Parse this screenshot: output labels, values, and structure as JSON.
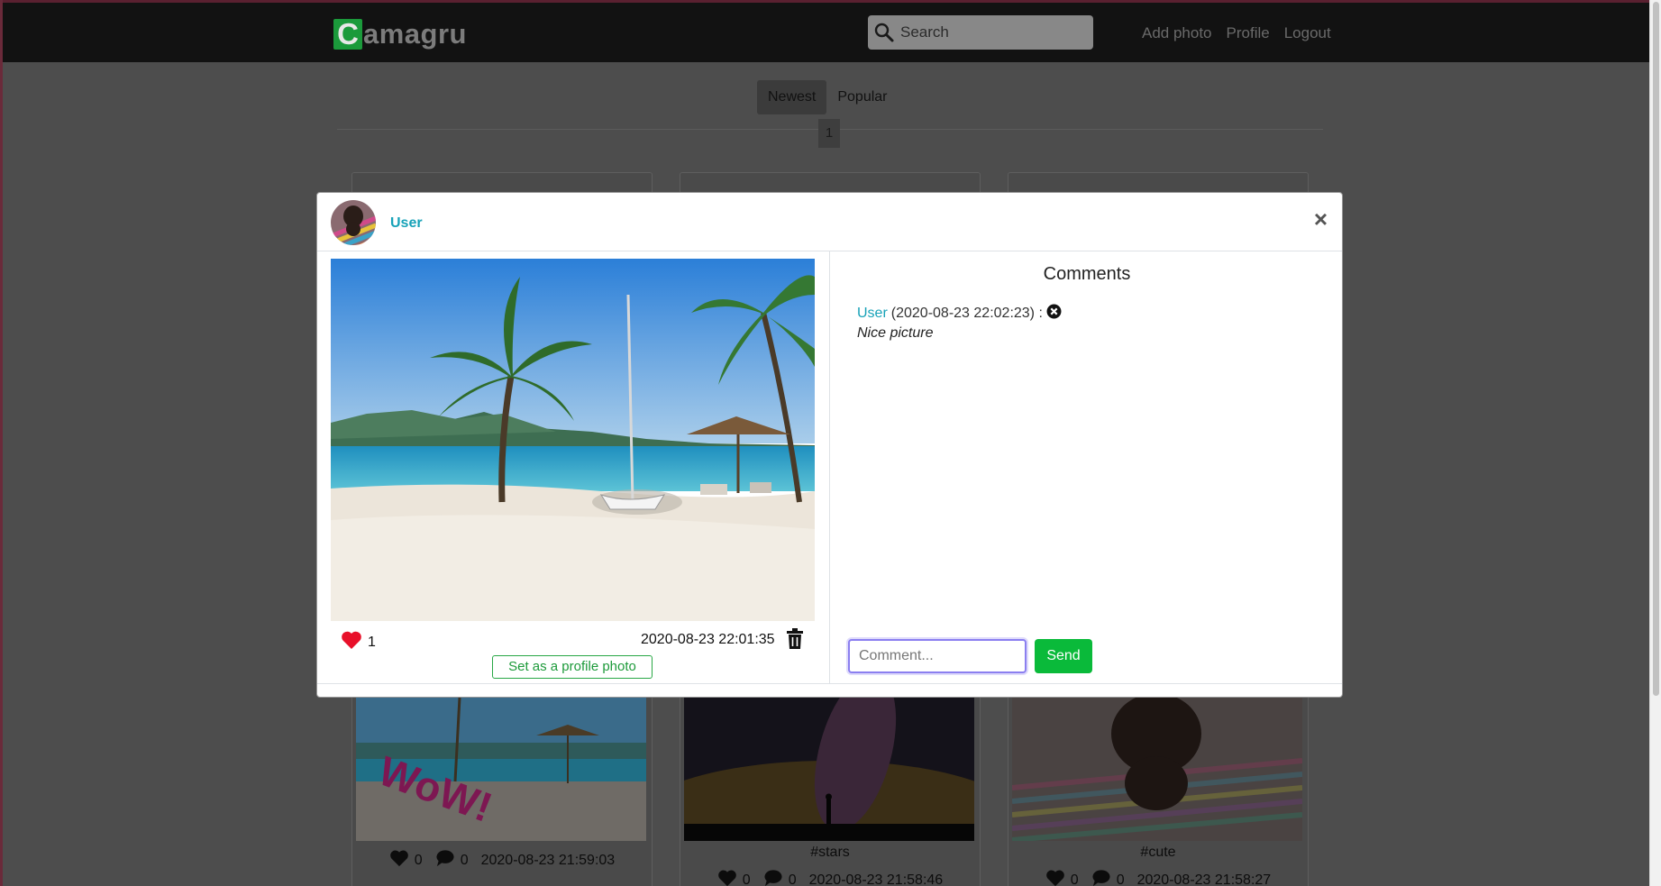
{
  "colors": {
    "accent_user": "#17a2b8",
    "send_button": "#0aba3a",
    "logo_green": "#1b9a3b",
    "like_red": "#e8102a"
  },
  "navbar": {
    "logo_letter": "C",
    "logo_rest": "amagru",
    "search_placeholder": "Search",
    "links": [
      "Add photo",
      "Profile",
      "Logout"
    ]
  },
  "filters": {
    "tabs": [
      "Newest",
      "Popular"
    ],
    "active": "Newest",
    "page": "1"
  },
  "cards": [
    {
      "tag": "",
      "likes": "0",
      "comments": "0",
      "date": "2020-08-23 21:59:03"
    },
    {
      "tag": "#stars",
      "likes": "0",
      "comments": "0",
      "date": "2020-08-23 21:58:46"
    },
    {
      "tag": "#cute",
      "likes": "0",
      "comments": "0",
      "date": "2020-08-23 21:58:27"
    }
  ],
  "modal": {
    "username": "User",
    "close_symbol": "×",
    "likes": "1",
    "date": "2020-08-23 22:01:35",
    "set_profile_label": "Set as a profile photo",
    "comments_title": "Comments",
    "comments": [
      {
        "user": "User",
        "time": "(2020-08-23 22:02:23) :",
        "text": "Nice picture"
      }
    ],
    "comment_placeholder": "Comment...",
    "send_label": "Send"
  },
  "icons": [
    "search-icon",
    "heart-icon",
    "comment-icon",
    "trash-icon",
    "remove-comment-icon",
    "close-icon"
  ]
}
